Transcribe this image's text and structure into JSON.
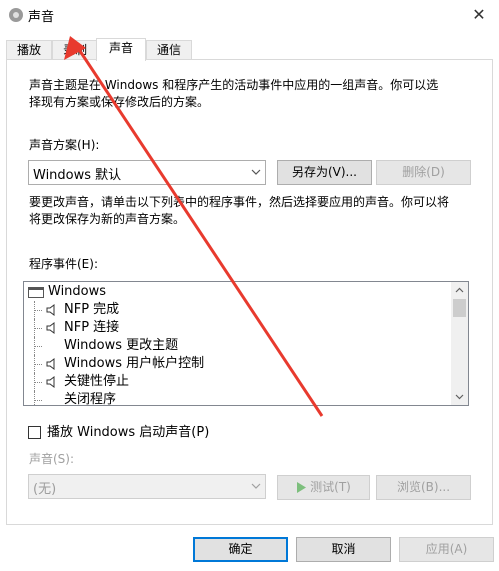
{
  "window": {
    "title": "声音",
    "close_glyph": "✕"
  },
  "tabs": [
    {
      "label": "播放",
      "active": false
    },
    {
      "label": "录制",
      "active": false
    },
    {
      "label": "声音",
      "active": true
    },
    {
      "label": "通信",
      "active": false
    }
  ],
  "intro_text": {
    "line1": "声音主题是在 Windows 和程序产生的活动事件中应用的一组声音。你可以选",
    "line2": "择现有方案或保存修改后的方案。"
  },
  "scheme": {
    "label": "声音方案(H):",
    "selected": "Windows 默认",
    "save_as_label": "另存为(V)...",
    "delete_label": "删除(D)"
  },
  "change_text": {
    "line1": "要更改声音，请单击以下列表中的程序事件，然后选择要应用的声音。你可以将",
    "line2": "将更改保存为新的声音方案。"
  },
  "events": {
    "label": "程序事件(E):",
    "items": [
      {
        "label": "Windows",
        "level": 0,
        "has_sound": false
      },
      {
        "label": "NFP 完成",
        "level": 1,
        "has_sound": true
      },
      {
        "label": "NFP 连接",
        "level": 1,
        "has_sound": true
      },
      {
        "label": "Windows 更改主题",
        "level": 1,
        "has_sound": false
      },
      {
        "label": "Windows 用户帐户控制",
        "level": 1,
        "has_sound": true
      },
      {
        "label": "关键性停止",
        "level": 1,
        "has_sound": true
      },
      {
        "label": "关闭程序",
        "level": 1,
        "has_sound": false
      }
    ]
  },
  "startup_sound": {
    "label": "播放 Windows 启动声音(P)",
    "checked": false
  },
  "sound": {
    "label": "声音(S):",
    "selected": "(无)",
    "test_label": "测试(T)",
    "browse_label": "浏览(B)..."
  },
  "footer": {
    "ok_label": "确定",
    "cancel_label": "取消",
    "apply_label": "应用(A)"
  },
  "colors": {
    "annotation_arrow": "#e83a2e",
    "focus_border": "#0078d7",
    "test_play_icon": "#7dbf7d"
  }
}
